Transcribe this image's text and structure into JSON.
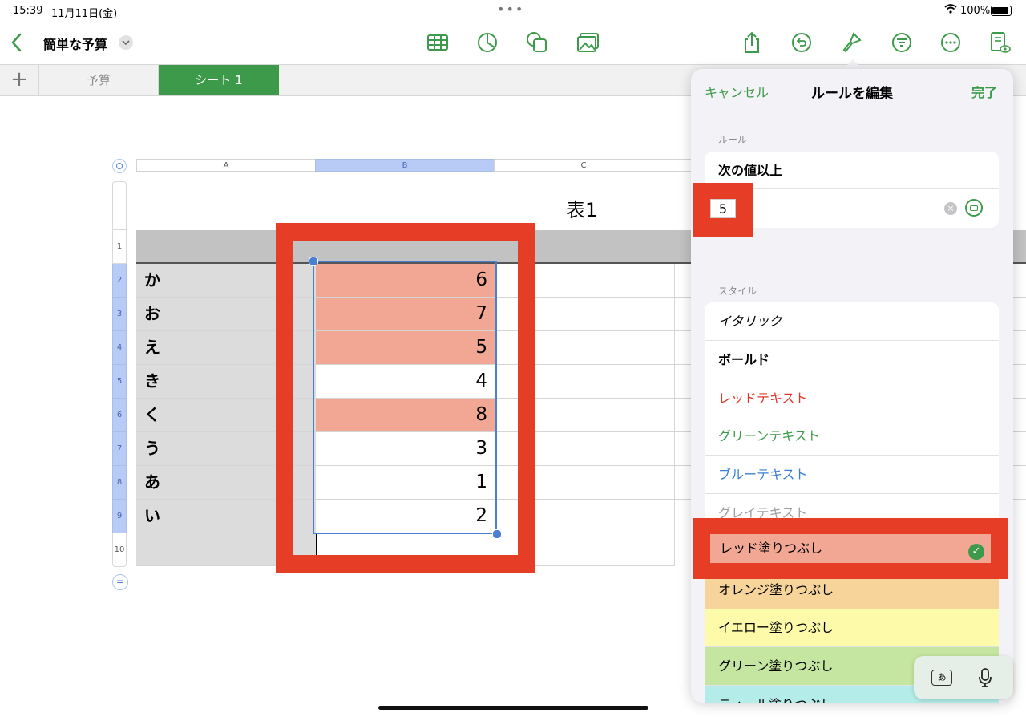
{
  "status_bar": {
    "time": "15:39",
    "date": "11月11日(金)",
    "battery": "100%"
  },
  "toolbar": {
    "doc_title": "簡単な予算",
    "icons": [
      "table-icon",
      "chart-icon",
      "shape-icon",
      "media-icon",
      "share-icon",
      "undo-icon",
      "format-brush-icon",
      "organize-icon",
      "more-icon",
      "document-view-icon"
    ]
  },
  "sheet_tabs": {
    "add": "+",
    "tabs": [
      {
        "label": "予算"
      },
      {
        "label": "シート 1"
      }
    ]
  },
  "table": {
    "title": "表1",
    "columns": [
      "A",
      "B",
      "C"
    ],
    "row_numbers": [
      "1",
      "2",
      "3",
      "4",
      "5",
      "6",
      "7",
      "8",
      "9",
      "10"
    ],
    "rows": [
      {
        "label": "か",
        "value": "6",
        "highlight": true
      },
      {
        "label": "お",
        "value": "7",
        "highlight": true
      },
      {
        "label": "え",
        "value": "5",
        "highlight": true
      },
      {
        "label": "き",
        "value": "4",
        "highlight": false
      },
      {
        "label": "く",
        "value": "8",
        "highlight": true
      },
      {
        "label": "う",
        "value": "3",
        "highlight": false
      },
      {
        "label": "あ",
        "value": "1",
        "highlight": false
      },
      {
        "label": "い",
        "value": "2",
        "highlight": false
      }
    ]
  },
  "panel": {
    "cancel": "キャンセル",
    "title": "ルールを編集",
    "done": "完了",
    "rule_section": "ルール",
    "rule_name": "次の値以上",
    "rule_value": "5",
    "style_section": "スタイル",
    "styles": [
      {
        "label": "イタリック",
        "color": "#000000",
        "bg": "#ffffff"
      },
      {
        "label": "ボールド",
        "color": "#000000",
        "bg": "#ffffff"
      },
      {
        "label": "レッドテキスト",
        "color": "#d93a2b",
        "bg": "#ffffff"
      },
      {
        "label": "グリーンテキスト",
        "color": "#3d9a4a",
        "bg": "#ffffff"
      },
      {
        "label": "ブルーテキスト",
        "color": "#3b7fd1",
        "bg": "#ffffff"
      },
      {
        "label": "グレイテキスト",
        "color": "#a0a0a0",
        "bg": "#ffffff"
      },
      {
        "label": "レッド塗りつぶし",
        "color": "#000000",
        "bg": "#f1a794",
        "selected": true
      },
      {
        "label": "オレンジ塗りつぶし",
        "color": "#000000",
        "bg": "#f6d49a"
      },
      {
        "label": "イエロー塗りつぶし",
        "color": "#000000",
        "bg": "#fdfbaa"
      },
      {
        "label": "グリーン塗りつぶし",
        "color": "#000000",
        "bg": "#c5e6a0"
      },
      {
        "label": "ティール塗りつぶし",
        "color": "#000000",
        "bg": "#b3ece8"
      }
    ]
  },
  "keyboard_bar": {
    "kana": "あ"
  },
  "colors": {
    "accent": "#3d9a4a",
    "highlight_fill": "#f1a794",
    "annotation_red": "#e53d26",
    "selection_blue": "#4a7fd6"
  }
}
